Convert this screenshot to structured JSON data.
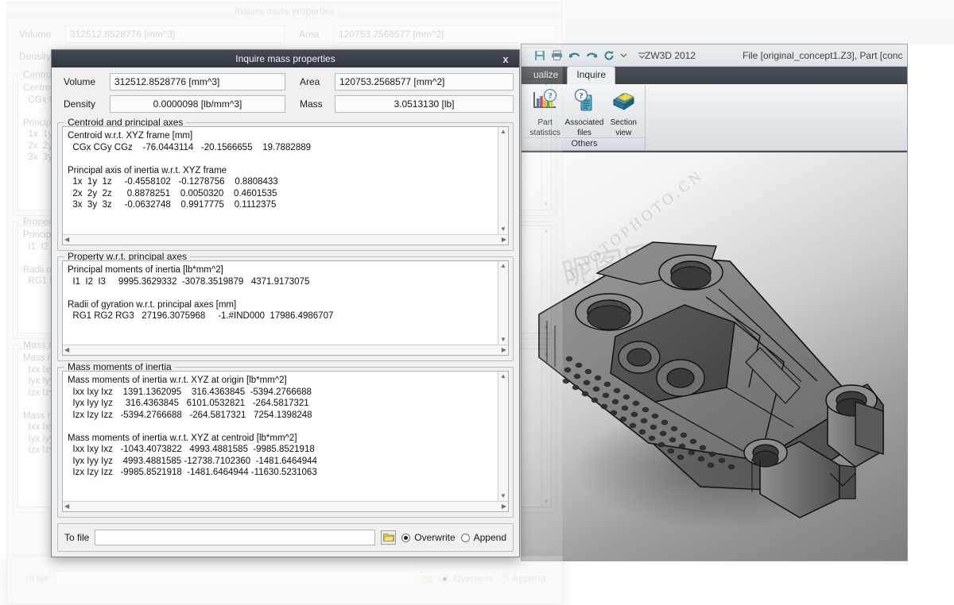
{
  "zw3d": {
    "app_title": "ZW3D 2012",
    "file_title": "File [original_concept1.Z3],  Part [conc",
    "quick_access": [
      "save-icon",
      "print-icon",
      "undo-icon",
      "redo-icon",
      "refresh-icon",
      "chevron-down-icon",
      "overflow-icon"
    ],
    "tabs": [
      {
        "label": "ualize",
        "active": false
      },
      {
        "label": "Inquire",
        "active": true
      }
    ],
    "ribbon": {
      "group_title": "Others",
      "buttons": [
        {
          "label_line1": "Part",
          "label_line2": "statistics",
          "icon": "part-statistics-icon"
        },
        {
          "label_line1": "Associated",
          "label_line2": "files",
          "icon": "associated-files-icon"
        },
        {
          "label_line1": "Section",
          "label_line2": "view",
          "icon": "section-view-icon"
        }
      ]
    },
    "viewport": {
      "watermark_1": "PHOTOPHOTO.CN",
      "watermark_2": "昵图网"
    }
  },
  "dialog": {
    "title": "Inquire mass properties",
    "close_label": "x",
    "fields": {
      "volume_label": "Volume",
      "volume_value": "312512.8528776 [mm^3]",
      "density_label": "Density",
      "density_value": "0.0000098 [lb/mm^3]",
      "area_label": "Area",
      "area_value": "120753.2568577 [mm^2]",
      "mass_label": "Mass",
      "mass_value": "3.0513130 [lb]"
    },
    "groups": [
      {
        "title": "Centroid and principal axes",
        "text": "Centroid w.r.t. XYZ frame [mm]\n  CGx CGy CGz    -76.0443114   -20.1566655    19.7882889\n\nPrincipal axis of inertia w.r.t. XYZ frame\n  1x  1y  1z     -0.4558102   -0.1278756    0.8808433\n  2x  2y  2z      0.8878251    0.0050320    0.4601535\n  3x  3y  3z     -0.0632748    0.9917775    0.1112375"
      },
      {
        "title": "Property w.r.t. principal axes",
        "text": "Principal moments of inertia [lb*mm^2]\n  I1  I2  I3     9995.3629332  -3078.3519879   4371.9173075\n\nRadii of gyration w.r.t. principal axes [mm]\n  RG1 RG2 RG3   27196.3075968     -1.#IND000  17986.4986707"
      },
      {
        "title": "Mass moments of inertia",
        "text": "Mass moments of inertia w.r.t. XYZ at origin [lb*mm^2]\n  Ixx Ixy Ixz    1391.1362095    316.4363845  -5394.2766688\n  Iyx Iyy Iyz     316.4363845   6101.0532821   -264.5817321\n  Izx Izy Izz   -5394.2766688   -264.5817321   7254.1398248\n\nMass moments of inertia w.r.t. XYZ at centroid [lb*mm^2]\n  Ixx Ixy Ixz   -1043.4073822   4993.4881585  -9985.8521918\n  Iyx Iyy Iyz    4993.4881585 -12738.7102360  -1481.6464944\n  Izx Izy Izz   -9985.8521918  -1481.6464944 -11630.5231063"
      }
    ],
    "footer": {
      "to_file_label": "To file",
      "to_file_value": "",
      "to_file_placeholder": "",
      "browse_icon": "folder-icon",
      "overwrite_label": "Overwrite",
      "overwrite_selected": true,
      "append_label": "Append",
      "append_selected": false
    }
  },
  "colors": {
    "dialog_titlebar": "#3a4048",
    "dialog_face": "#f0f0f0",
    "field_bg": "#fbfbfb",
    "ribbon_tab_bar": "#454b54",
    "accent_folder": "#e8c84a"
  }
}
